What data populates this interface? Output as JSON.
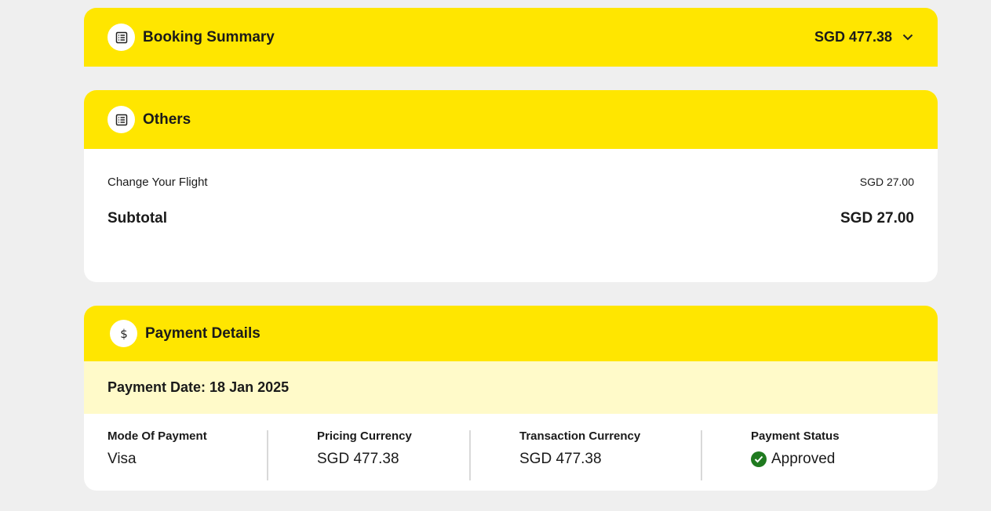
{
  "booking_summary": {
    "title": "Booking Summary",
    "total": "SGD 477.38",
    "icon": "receipt-icon"
  },
  "others": {
    "title": "Others",
    "icon": "receipt-icon",
    "items": [
      {
        "label": "Change Your Flight",
        "amount": "SGD 27.00"
      }
    ],
    "subtotal_label": "Subtotal",
    "subtotal_amount": "SGD 27.00"
  },
  "payment": {
    "title": "Payment Details",
    "icon": "dollar-icon",
    "date_text": "Payment Date: 18 Jan 2025",
    "columns": [
      {
        "label": "Mode Of Payment",
        "value": "Visa"
      },
      {
        "label": "Pricing Currency",
        "value": "SGD 477.38"
      },
      {
        "label": "Transaction Currency",
        "value": "SGD 477.38"
      },
      {
        "label": "Payment Status",
        "value": "Approved"
      }
    ]
  },
  "colors": {
    "accent_yellow": "#ffe600",
    "light_yellow": "#fffac9",
    "approved_green": "#1f7a1f"
  }
}
